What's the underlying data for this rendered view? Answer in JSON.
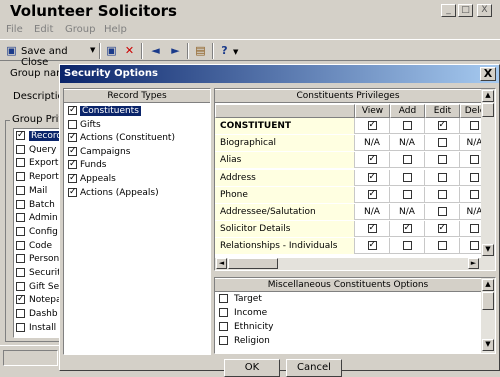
{
  "app": {
    "title": "Volunteer Solicitors",
    "title_buttons": [
      "_",
      "□",
      "X"
    ],
    "menu": [
      "File",
      "Edit",
      "Group",
      "Help"
    ],
    "toolbar": {
      "save_close_label": "Save and Close"
    },
    "labels": {
      "group_name": "Group name",
      "description": "Description",
      "group_privileges": "Group Privil"
    },
    "group_list": [
      {
        "label": "Records",
        "checked": true
      },
      {
        "label": "Query",
        "checked": false
      },
      {
        "label": "Export",
        "checked": false
      },
      {
        "label": "Reports",
        "checked": false
      },
      {
        "label": "Mail",
        "checked": false
      },
      {
        "label": "Batch",
        "checked": false
      },
      {
        "label": "Admin",
        "checked": false
      },
      {
        "label": "Config",
        "checked": false
      },
      {
        "label": "Code",
        "checked": false
      },
      {
        "label": "Person",
        "checked": false
      },
      {
        "label": "Security",
        "checked": false
      },
      {
        "label": "Gift Se",
        "checked": false
      },
      {
        "label": "Notepad",
        "checked": true
      },
      {
        "label": "Dashb",
        "checked": false
      },
      {
        "label": "Install",
        "checked": false
      }
    ]
  },
  "dialog": {
    "title": "Security Options",
    "close_label": "X",
    "record_types_header": "Record Types",
    "record_types": [
      {
        "label": "Constituents",
        "checked": true,
        "selected": true
      },
      {
        "label": "Gifts",
        "checked": false,
        "selected": false
      },
      {
        "label": "Actions (Constituent)",
        "checked": true,
        "selected": false
      },
      {
        "label": "Campaigns",
        "checked": true,
        "selected": false
      },
      {
        "label": "Funds",
        "checked": true,
        "selected": false
      },
      {
        "label": "Appeals",
        "checked": true,
        "selected": false
      },
      {
        "label": "Actions (Appeals)",
        "checked": true,
        "selected": false
      }
    ],
    "privileges_header": "Constituents Privileges",
    "privileges_columns": [
      "View",
      "Add",
      "Edit",
      "Dele"
    ],
    "privileges_rows": [
      {
        "name": "CONSTITUENT",
        "header": true,
        "cells": [
          "x",
          "",
          "x",
          ""
        ]
      },
      {
        "name": "Biographical",
        "header": false,
        "cells": [
          "N/A",
          "N/A",
          "",
          "N/A"
        ]
      },
      {
        "name": "Alias",
        "header": false,
        "cells": [
          "x",
          "",
          "",
          ""
        ]
      },
      {
        "name": "Address",
        "header": false,
        "cells": [
          "x",
          "",
          "",
          ""
        ]
      },
      {
        "name": "Phone",
        "header": false,
        "cells": [
          "x",
          "",
          "",
          ""
        ]
      },
      {
        "name": "Addressee/Salutation",
        "header": false,
        "cells": [
          "N/A",
          "N/A",
          "",
          "N/A"
        ]
      },
      {
        "name": "Solicitor Details",
        "header": false,
        "cells": [
          "x",
          "x",
          "x",
          ""
        ]
      },
      {
        "name": "Relationships - Individuals",
        "header": false,
        "cells": [
          "x",
          "",
          "",
          ""
        ]
      }
    ],
    "misc_header": "Miscellaneous Constituents Options",
    "misc_options": [
      {
        "label": "Target",
        "checked": false
      },
      {
        "label": "Income",
        "checked": false
      },
      {
        "label": "Ethnicity",
        "checked": false
      },
      {
        "label": "Religion",
        "checked": false
      }
    ],
    "ok_label": "OK",
    "cancel_label": "Cancel"
  }
}
